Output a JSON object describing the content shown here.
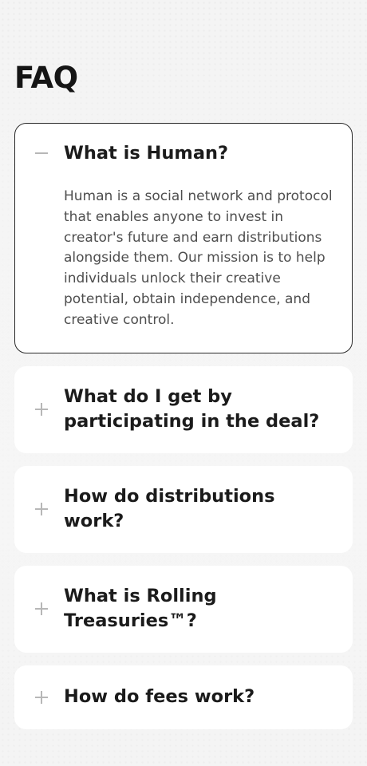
{
  "page": {
    "title": "FAQ"
  },
  "faq": [
    {
      "question": "What is Human?",
      "answer": "Human is a social network and protocol that enables anyone to invest in creator's future and earn distributions alongside them. Our mission is to help individuals unlock their creative potential, obtain independence, and creative control.",
      "expanded": true,
      "icon": "minus-icon"
    },
    {
      "question": "What do I get by participating in the deal?",
      "expanded": false,
      "icon": "plus-icon"
    },
    {
      "question": "How do distributions work?",
      "expanded": false,
      "icon": "plus-icon"
    },
    {
      "question": "What is Rolling Treasuries™?",
      "expanded": false,
      "icon": "plus-icon"
    },
    {
      "question": "How do fees work?",
      "expanded": false,
      "icon": "plus-icon"
    }
  ],
  "colors": {
    "background": "#f3f3f3",
    "card": "#ffffff",
    "open_border": "#2a2a2a",
    "icon": "#b7b7b7",
    "question_text": "#1b1b1b",
    "answer_text": "#4e4e4e"
  }
}
